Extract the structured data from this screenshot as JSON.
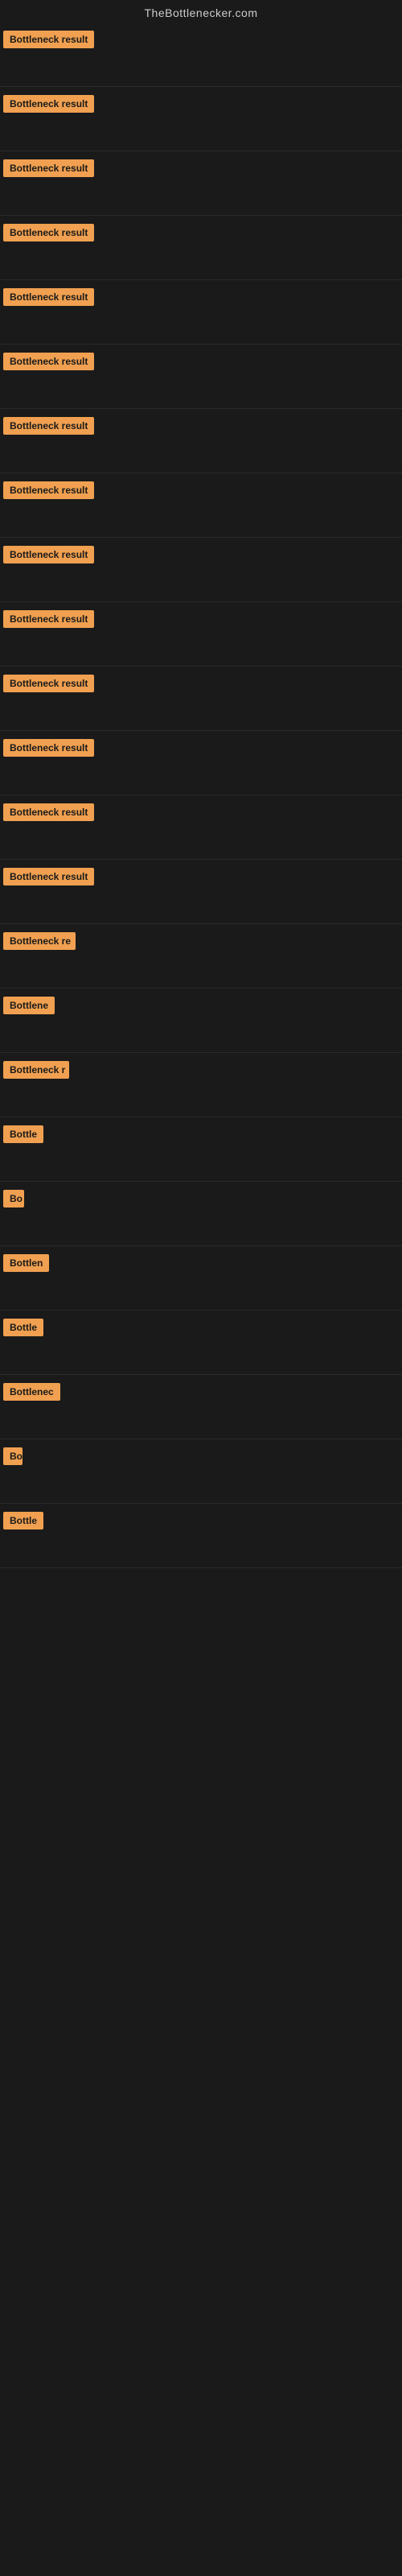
{
  "site": {
    "title": "TheBottlenecker.com"
  },
  "items": [
    {
      "label": "Bottleneck result",
      "badgeWidth": 120
    },
    {
      "label": "Bottleneck result",
      "badgeWidth": 120
    },
    {
      "label": "Bottleneck result",
      "badgeWidth": 120
    },
    {
      "label": "Bottleneck result",
      "badgeWidth": 120
    },
    {
      "label": "Bottleneck result",
      "badgeWidth": 120
    },
    {
      "label": "Bottleneck result",
      "badgeWidth": 120
    },
    {
      "label": "Bottleneck result",
      "badgeWidth": 120
    },
    {
      "label": "Bottleneck result",
      "badgeWidth": 120
    },
    {
      "label": "Bottleneck result",
      "badgeWidth": 120
    },
    {
      "label": "Bottleneck result",
      "badgeWidth": 120
    },
    {
      "label": "Bottleneck result",
      "badgeWidth": 120
    },
    {
      "label": "Bottleneck result",
      "badgeWidth": 120
    },
    {
      "label": "Bottleneck result",
      "badgeWidth": 120
    },
    {
      "label": "Bottleneck result",
      "badgeWidth": 120
    },
    {
      "label": "Bottleneck re",
      "badgeWidth": 90
    },
    {
      "label": "Bottlene",
      "badgeWidth": 72
    },
    {
      "label": "Bottleneck r",
      "badgeWidth": 82
    },
    {
      "label": "Bottle",
      "badgeWidth": 56
    },
    {
      "label": "Bo",
      "badgeWidth": 26
    },
    {
      "label": "Bottlen",
      "badgeWidth": 64
    },
    {
      "label": "Bottle",
      "badgeWidth": 52
    },
    {
      "label": "Bottlenec",
      "badgeWidth": 74
    },
    {
      "label": "Bo",
      "badgeWidth": 24
    },
    {
      "label": "Bottle",
      "badgeWidth": 50
    }
  ]
}
